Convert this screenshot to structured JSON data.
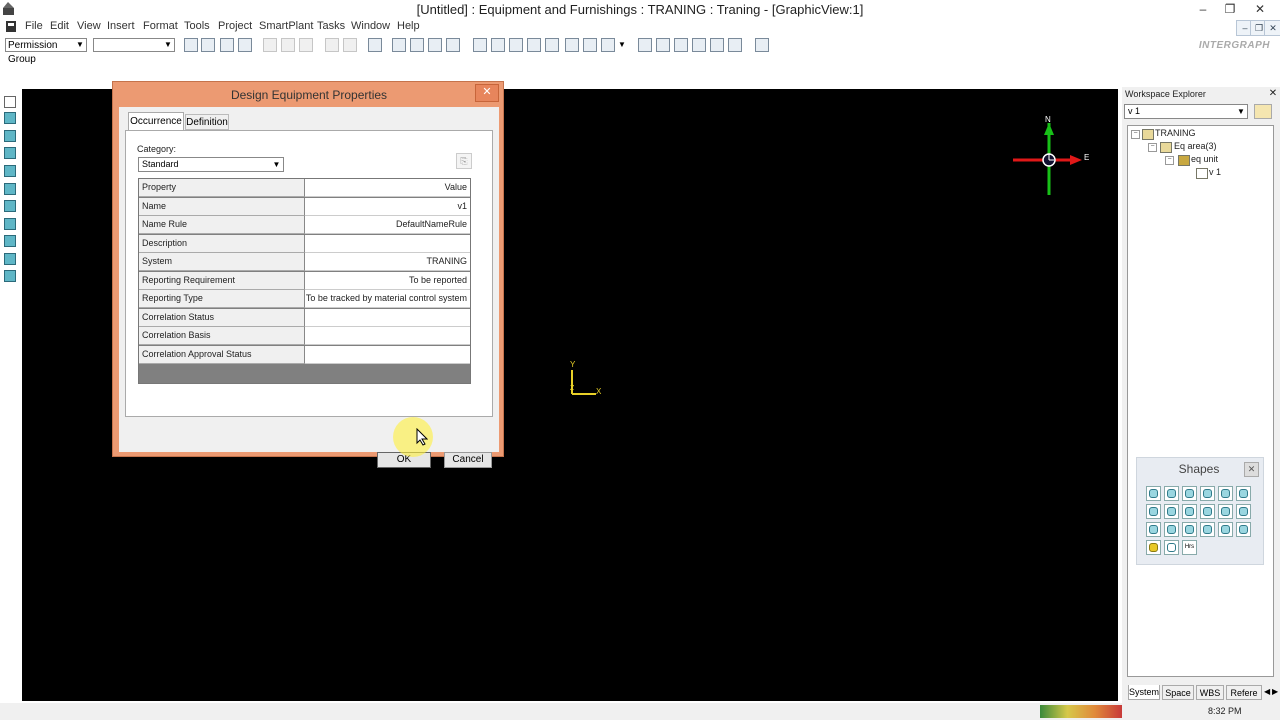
{
  "window": {
    "title": "[Untitled] : Equipment and Furnishings : TRANING : Traning - [GraphicView:1]",
    "controls": [
      "–",
      "❐",
      "✕"
    ]
  },
  "menu": [
    "File",
    "Edit",
    "View",
    "Insert",
    "Format",
    "Tools",
    "Project",
    "SmartPlant",
    "Tasks",
    "Window",
    "Help"
  ],
  "toolbar": {
    "permission_group": "Permission Group",
    "second_select": "",
    "logo_text": "INTERGRAPH"
  },
  "dialog": {
    "title": "Design Equipment Properties",
    "close": "✕",
    "tabs": [
      "Occurrence",
      "Definition"
    ],
    "category_label": "Category:",
    "category_value": "Standard",
    "grid_header": {
      "property": "Property",
      "value": "Value"
    },
    "rows": [
      {
        "property": "Name",
        "value": "v1"
      },
      {
        "property": "Name Rule",
        "value": "DefaultNameRule"
      },
      {
        "property": "Description",
        "value": ""
      },
      {
        "property": "System",
        "value": "TRANING"
      },
      {
        "property": "Reporting Requirement",
        "value": "To be reported"
      },
      {
        "property": "Reporting Type",
        "value": "To be tracked by material control system"
      },
      {
        "property": "Correlation Status",
        "value": ""
      },
      {
        "property": "Correlation Basis",
        "value": ""
      },
      {
        "property": "Correlation Approval Status",
        "value": ""
      }
    ],
    "ok_label": "OK",
    "cancel_label": "Cancel"
  },
  "compass": {
    "north": "N",
    "east": "E"
  },
  "axis": {
    "y": "Y",
    "x": "X",
    "z": "Z"
  },
  "workspace_explorer": {
    "title": "Workspace Explorer",
    "filter_value": "v 1",
    "tree": [
      "TRANING",
      "Eq area(3)",
      "eq unit",
      "v 1"
    ],
    "tabs": [
      "System",
      "Space",
      "WBS",
      "Refere"
    ]
  },
  "shapes": {
    "title": "Shapes",
    "special_label": "Hrs"
  },
  "status": {
    "time": "8:32 PM"
  },
  "colors": {
    "dialog_border": "#ec9a72",
    "viewport": "#000000",
    "compass_north": "#18c018",
    "compass_east": "#e01818"
  }
}
